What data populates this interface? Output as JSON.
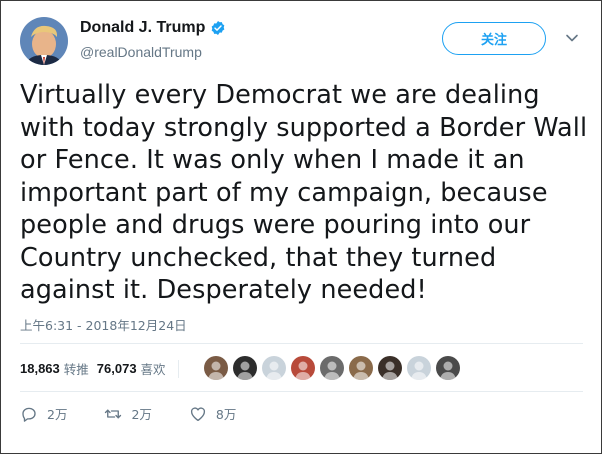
{
  "author": {
    "display_name": "Donald J. Trump",
    "handle": "@realDonaldTrump",
    "verified": true
  },
  "follow_button": {
    "label": "关注"
  },
  "tweet": {
    "text": "Virtually every Democrat we are dealing with today strongly supported a Border Wall or Fence. It was only when I made it an important part of my campaign, because people and drugs were pouring into our Country unchecked, that they turned against it. Desperately needed!",
    "timestamp": "上午6:31 - 2018年12月24日"
  },
  "stats": {
    "retweets_count": "18,863",
    "retweets_label": "转推",
    "likes_count": "76,073",
    "likes_label": "喜欢"
  },
  "liker_avatars": [
    {
      "color": "#7a5b45"
    },
    {
      "color": "#2d2d2d"
    },
    {
      "color": "#c9d3db"
    },
    {
      "color": "#b84a3a"
    },
    {
      "color": "#6b6b6b"
    },
    {
      "color": "#8a6a4a"
    },
    {
      "color": "#3a2f28"
    },
    {
      "color": "#c9d3db"
    },
    {
      "color": "#4a4a4a"
    }
  ],
  "actions": {
    "reply_count": "2万",
    "retweet_count": "2万",
    "like_count": "8万"
  },
  "colors": {
    "accent": "#1da1f2",
    "secondary_text": "#657786",
    "primary_text": "#14171a"
  }
}
